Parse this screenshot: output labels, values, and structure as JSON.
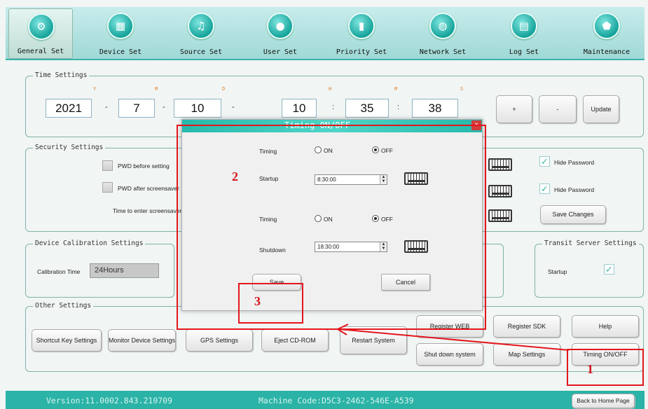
{
  "nav": [
    {
      "label": "General Set",
      "icon": "gear-icon",
      "glyph": "⚙"
    },
    {
      "label": "Device Set",
      "icon": "grid-icon",
      "glyph": "▦"
    },
    {
      "label": "Source Set",
      "icon": "music-note-icon",
      "glyph": "♫"
    },
    {
      "label": "User Set",
      "icon": "user-icon",
      "glyph": "●"
    },
    {
      "label": "Priority Set",
      "icon": "bar-chart-icon",
      "glyph": "▮"
    },
    {
      "label": "Network Set",
      "icon": "globe-icon",
      "glyph": "◍"
    },
    {
      "label": "Log Set",
      "icon": "calendar-icon",
      "glyph": "▤"
    },
    {
      "label": "Maintenance",
      "icon": "shield-icon",
      "glyph": "⬟"
    }
  ],
  "time": {
    "title": "Time Settings",
    "labels": {
      "y": "Y",
      "m": "M",
      "d": "D",
      "h": "H",
      "mi": "M",
      "s": "S"
    },
    "year": "2021",
    "month": "7",
    "day": "10",
    "hour": "10",
    "minute": "35",
    "second": "38",
    "dash": "-",
    "colon": ":",
    "plus": "+",
    "minus": "-",
    "update": "Update"
  },
  "security": {
    "title": "Security Settings",
    "pwd_before": "PWD before setting",
    "pwd_after": "PWD after screensaver",
    "screensaver_time": "Time to enter screensaver",
    "hide_password_1": "Hide Password",
    "hide_password_2": "Hide Password",
    "save_changes": "Save Changes"
  },
  "calibration": {
    "title": "Device Calibration Settings",
    "label": "Calibration Time",
    "value": "24Hours"
  },
  "transit": {
    "title": "Transit Server Settings",
    "startup": "Startup"
  },
  "other": {
    "title": "Other Settings",
    "shortcut": "Shortcut Key Settings",
    "monitor": "Monitor Device Settings",
    "gps": "GPS Settings",
    "eject": "Eject CD-ROM",
    "restart": "Restart System",
    "register_web": "Register WEB",
    "register_sdk": "Register SDK",
    "help": "Help",
    "shutdown": "Shut down system",
    "map": "Map Settings",
    "timing": "Timing ON/OFF"
  },
  "dialog": {
    "title": "Timing ON/OFF",
    "close": "×",
    "timing1": "Timing",
    "on1": "ON",
    "off1": "OFF",
    "startup": "Startup",
    "startup_time": "8:30:00",
    "timing2": "Timing",
    "on2": "ON",
    "off2": "OFF",
    "shutdown": "Shutdown",
    "shutdown_time": "18:30:00",
    "save": "Save",
    "cancel": "Cancel",
    "spin_up": "▲",
    "spin_down": "▼"
  },
  "footer": {
    "version": "Version:11.0002.843.210709",
    "machine": "Machine Code:D5C3-2462-546E-A539",
    "home": "Back to Home Page"
  },
  "annotations": {
    "n1": "1",
    "n2": "2",
    "n3": "3",
    "color": "#e3161c"
  }
}
